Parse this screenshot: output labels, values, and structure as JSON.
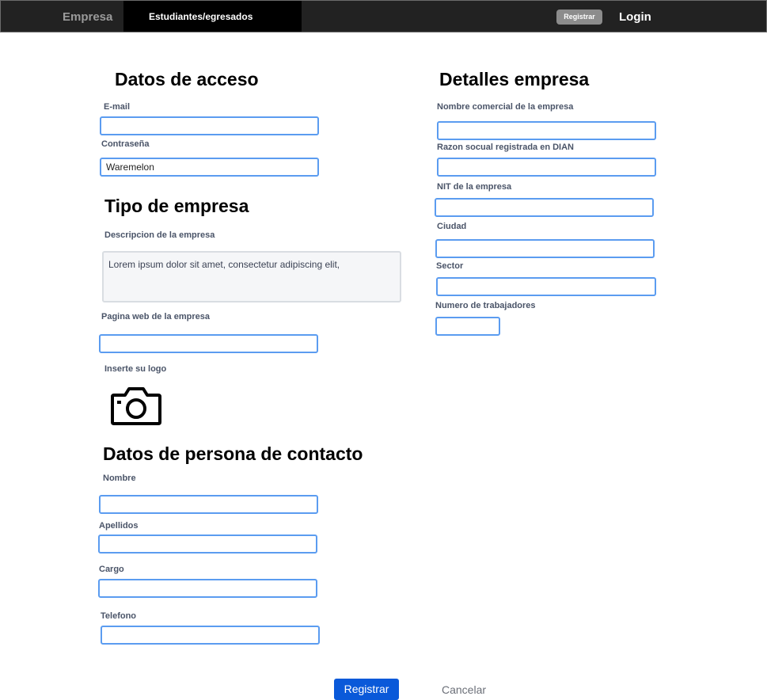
{
  "nav": {
    "tab_empresa": "Empresa",
    "tab_estudiantes": "Estudiantes/egresados",
    "register_button": "Registrar",
    "login_button": "Login"
  },
  "access": {
    "heading": "Datos de acceso",
    "email_label": "E-mail",
    "email_value": "",
    "password_label": "Contraseña",
    "password_value": "Waremelon"
  },
  "company_type": {
    "heading": "Tipo de empresa",
    "description_label": "Descripcion de la empresa",
    "description_value": "Lorem ipsum dolor sit amet, consectetur adipiscing elit,",
    "website_label": "Pagina web de la empresa",
    "website_value": "",
    "logo_label": "Inserte su logo",
    "logo_icon": "camera-icon"
  },
  "contact": {
    "heading": "Datos de persona de contacto",
    "name_label": "Nombre",
    "lastname_label": "Apellidos",
    "role_label": "Cargo",
    "phone_label": "Telefono"
  },
  "details": {
    "heading": "Detalles empresa",
    "trade_name_label": "Nombre comercial de la empresa",
    "legal_name_label": "Razon socual registrada en DIAN",
    "nit_label": "NIT de la empresa",
    "city_label": "Ciudad",
    "sector_label": "Sector",
    "workers_label": "Numero de trabajadores"
  },
  "actions": {
    "submit": "Registrar",
    "cancel": "Cancelar"
  },
  "colors": {
    "topbar": "#222222",
    "input_border": "#5b9cf0",
    "primary_button": "#0a59d9"
  }
}
